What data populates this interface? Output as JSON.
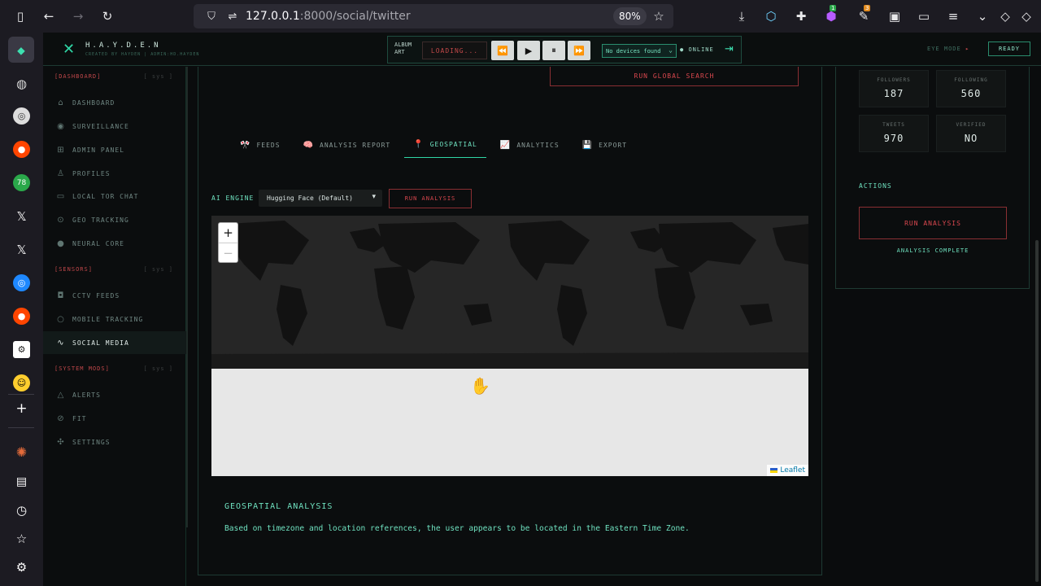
{
  "browser": {
    "url_host": "127.0.0.1",
    "url_rest": ":8000/social/twitter",
    "zoom": "80%",
    "ext_badge_1": "1",
    "ext_badge_2": "3"
  },
  "ff_sidebar": {
    "badge_78": "78"
  },
  "header": {
    "logo_title": "H.A.Y.D.E.N",
    "logo_sub": "CREATED BY HAYDEN | ADMIN:HD.HAYDEN",
    "album_art": "ALBUM ART",
    "loading": "LOADING...",
    "device_select": "No devices found",
    "online": "ONLINE",
    "eye_mode": "EYE MODE",
    "ready": "READY"
  },
  "sidebar": {
    "dashboard_head": "[DASHBOARD]",
    "sensors_head": "[SENSORS]",
    "system_head": "[SYSTEM MODS]",
    "sys_tag": "[ sys ]",
    "items": [
      {
        "label": "DASHBOARD",
        "icon": "home-icon"
      },
      {
        "label": "SURVEILLANCE",
        "icon": "eye-icon"
      },
      {
        "label": "ADMIN PANEL",
        "icon": "grid-icon"
      },
      {
        "label": "PROFILES",
        "icon": "user-icon"
      },
      {
        "label": "LOCAL TOR CHAT",
        "icon": "chat-icon"
      },
      {
        "label": "GEO TRACKING",
        "icon": "pin-icon"
      },
      {
        "label": "NEURAL CORE",
        "icon": "brain-icon"
      },
      {
        "label": "CCTV FEEDS",
        "icon": "camera-icon"
      },
      {
        "label": "MOBILE TRACKING",
        "icon": "search-icon"
      },
      {
        "label": "SOCIAL MEDIA",
        "icon": "activity-icon"
      },
      {
        "label": "ALERTS",
        "icon": "alert-icon"
      },
      {
        "label": "FIT",
        "icon": "check-circle-icon"
      },
      {
        "label": "SETTINGS",
        "icon": "gear-icon"
      }
    ]
  },
  "main": {
    "global_search": "RUN GLOBAL SEARCH",
    "tabs": [
      {
        "label": "FEEDS"
      },
      {
        "label": "ANALYSIS REPORT"
      },
      {
        "label": "GEOSPATIAL"
      },
      {
        "label": "ANALYTICS"
      },
      {
        "label": "EXPORT"
      }
    ],
    "ai_engine_label": "AI ENGINE",
    "ai_engine_value": "Hugging Face (Default)",
    "run_analysis": "RUN ANALYSIS",
    "map_attribution": "Leaflet",
    "geo_title": "GEOSPATIAL ANALYSIS",
    "geo_text": "Based on timezone and location references, the user appears to be located in the Eastern Time Zone."
  },
  "right": {
    "followers_label": "FOLLOWERS",
    "followers": "187",
    "following_label": "FOLLOWING",
    "following": "560",
    "tweets_label": "TWEETS",
    "tweets": "970",
    "verified_label": "VERIFIED",
    "verified": "NO",
    "actions_label": "ACTIONS",
    "run_analysis": "RUN ANALYSIS",
    "status": "ANALYSIS COMPLETE"
  },
  "colors": {
    "accent": "#2fd6a5",
    "danger": "#d9474e",
    "background": "#0a0c0d"
  }
}
